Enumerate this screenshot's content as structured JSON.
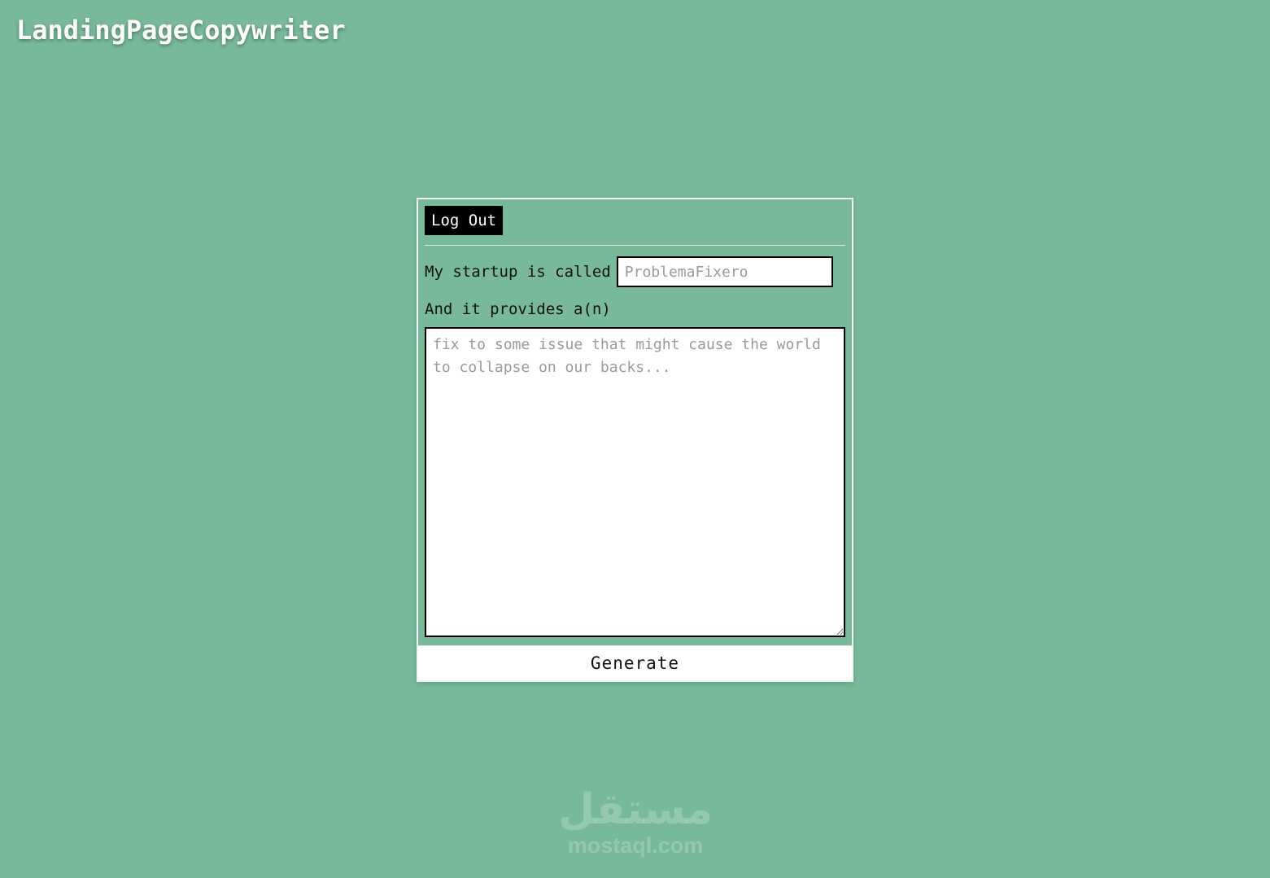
{
  "header": {
    "brand": "LandingPageCopywriter"
  },
  "form": {
    "logout_label": "Log Out",
    "startup_label": "My startup is called",
    "startup_placeholder": "ProblemaFixero",
    "startup_value": "",
    "provides_label": "And it provides a(n)",
    "provides_placeholder": "fix to some issue that might cause the world to collapse on our backs...",
    "provides_value": "",
    "generate_label": "Generate"
  },
  "watermark": {
    "arabic": "مستقل",
    "latin": "mostaql.com"
  },
  "colors": {
    "background": "#77b999",
    "button_dark": "#000000",
    "text": "#111111"
  }
}
